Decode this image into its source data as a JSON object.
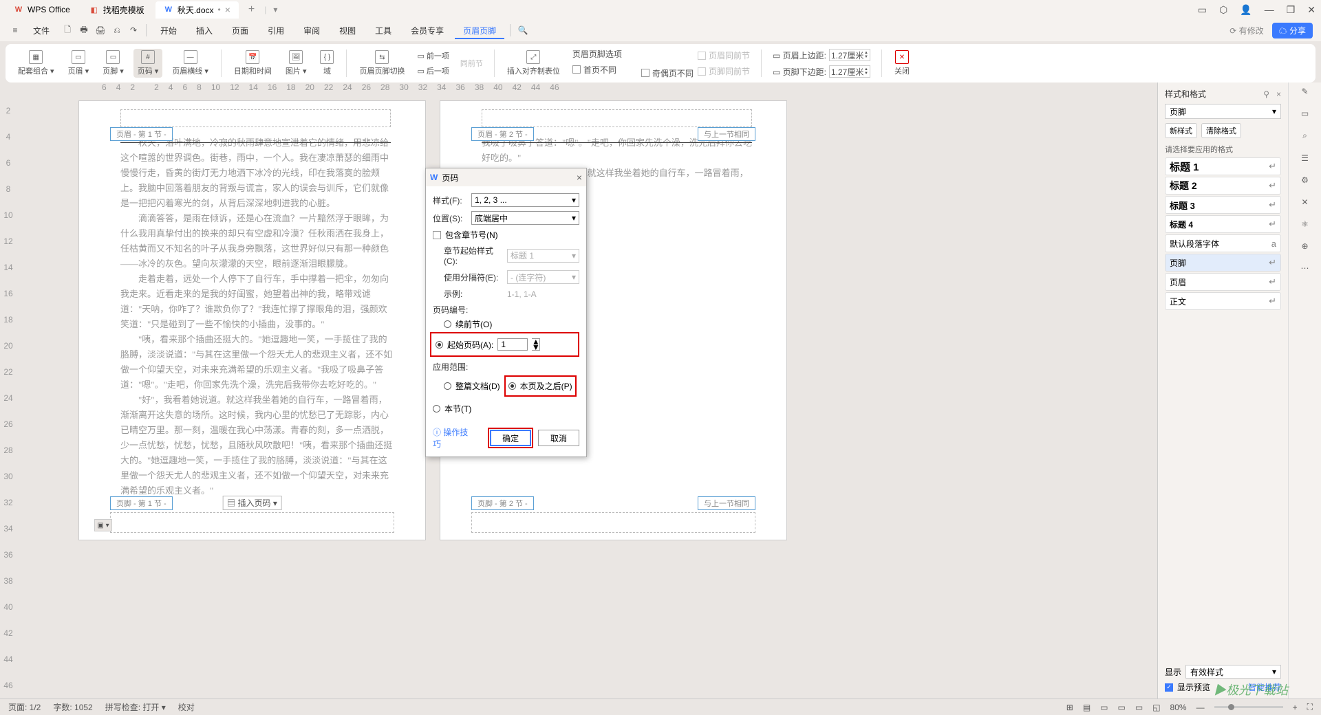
{
  "titlebar": {
    "app": "WPS Office",
    "tabs": [
      {
        "icon": "◧",
        "color": "#d94b3a",
        "label": "找稻壳模板"
      },
      {
        "icon": "W",
        "color": "#3a7afe",
        "label": "秋天.docx",
        "active": true,
        "dirty": "•"
      }
    ],
    "add": "+",
    "win": [
      "▭",
      "⬡",
      "👤",
      "—",
      "❐",
      "✕"
    ]
  },
  "menubar": {
    "left": [
      "≡",
      "文件",
      "🗋",
      "🖶",
      "🖨",
      "⎌",
      "↷"
    ],
    "tabs": [
      "开始",
      "插入",
      "页面",
      "引用",
      "审阅",
      "视图",
      "工具",
      "会员专享",
      "页眉页脚"
    ],
    "active": "页眉页脚",
    "search": "🔍",
    "changes": "⟳ 有修改",
    "share": "☁ 分享"
  },
  "ribbon": {
    "g1": [
      {
        "i": "▦",
        "l": "配套组合 ▾"
      },
      {
        "i": "▭",
        "l": "页眉 ▾"
      },
      {
        "i": "▭",
        "l": "页脚 ▾"
      },
      {
        "i": "#",
        "l": "页码 ▾"
      },
      {
        "i": "—",
        "l": "页眉横线 ▾"
      }
    ],
    "g2": [
      {
        "i": "📅",
        "l": "日期和时间"
      },
      {
        "i": "🖼",
        "l": "图片 ▾"
      },
      {
        "i": "{ }",
        "l": "域"
      }
    ],
    "g3": [
      {
        "i": "⇆",
        "l": "页眉页脚切换"
      }
    ],
    "g3b": [
      {
        "l": "▭ 前一项"
      },
      {
        "l": "▭ 后一项"
      },
      {
        "l": "同前节",
        "dis": true
      }
    ],
    "g4": [
      {
        "i": "⤢",
        "l": "插入对齐制表位"
      }
    ],
    "g4b": [
      {
        "l": "页眉页脚选项"
      },
      {
        "c": true,
        "l": "首页不同"
      },
      {
        "c": true,
        "l": "奇偶页不同"
      }
    ],
    "g4c": [
      {
        "c": true,
        "l": "页眉同前节",
        "dis": true
      },
      {
        "c": true,
        "l": "页脚同前节",
        "dis": true
      }
    ],
    "g5": [
      {
        "l": "▭ 页眉上边距:",
        "v": "1.27厘米"
      },
      {
        "l": "▭ 页脚下边距:",
        "v": "1.27厘米"
      }
    ],
    "g6": [
      {
        "i": "✕",
        "l": "关闭"
      }
    ]
  },
  "ruler": {
    "h": [
      "6",
      "4",
      "2",
      "",
      "2",
      "4",
      "6",
      "8",
      "10",
      "12",
      "14",
      "16",
      "18",
      "20",
      "22",
      "24",
      "26",
      "28",
      "30",
      "32",
      "34",
      "36",
      "38",
      "40",
      "42",
      "44",
      "46"
    ],
    "v": [
      "",
      "2",
      "4",
      "6",
      "8",
      "10",
      "12",
      "14",
      "16",
      "18",
      "20",
      "22",
      "24",
      "26",
      "28",
      "30",
      "32",
      "34",
      "36",
      "38",
      "40",
      "42",
      "44",
      "46"
    ]
  },
  "page1": {
    "hdr": "页眉 - 第 1 节 -",
    "ftr": "页脚 - 第 1 节 -",
    "ins": "▤ 插入页码 ▾",
    "text": "　　秋天，落叶满地，冷寂的秋雨肆意地宣泄着它的情绪，用悲凉给这个喧嚣的世界调色。街巷，雨中，一个人。我在凄凉萧瑟的细雨中慢慢行走，昏黄的街灯无力地洒下冰冷的光线，印在我落寞的脸颊上。我脑中回落着朋友的背叛与谎言，家人的误会与训斥，它们就像是一把把闪着寒光的剑，从背后深深地刺进我的心脏。\n　　滴滴答答，是雨在倾诉，还是心在流血？一片黯然浮于眼眸，为什么我用真挚付出的换来的却只有空虚和冷漠？任秋雨洒在我身上，任枯黄而又不知名的叶子从我身旁飘落，这世界好似只有那一种颜色——冰冷的灰色。望向灰濛濛的天空，眼前逐渐泪眼朦胧。\n　　走着走着，远处一个人停下了自行车，手中撑着一把伞，勿匆向我走来。近看走来的是我的好闺蜜，她望着出神的我，略带戏谑道：\"天呐，你咋了？谁欺负你了？\"我连忙撑了撑眼角的泪，强颜欢笑道：\"只是碰到了一些不愉快的小插曲，没事的。\"\n　　\"咦，看来那个插曲还挺大的。\"她逗趣地一笑，一手揽住了我的胳膊，淡淡说道：\"与其在这里做一个怨天尤人的悲观主义者，还不如做一个仰望天空，对未来充满希望的乐观主义者。\"我吸了吸鼻子答道：\"嗯\"。\"走吧，你回家先洗个澡，洗完后我带你去吃好吃的。\"\n　　\"好\"，我看着她说道。就这样我坐着她的自行车，一路冒着雨，渐渐离开这失意的场所。这时候，我内心里的忧愁已了无踪影，内心已晴空万里。那一刻，温暖在我心中荡漾。青春的刻，多一点洒脱，少一点忧愁，忧愁，忧愁，且随秋风吹散吧！\"咦，看来那个插曲还挺大的。\"她逗趣地一笑，一手揽住了我的胳膊，淡淡说道：\"与其在这里做一个怨天尤人的悲观主义者，还不如做一个仰望天空，对未来充满希望的乐观主义者。\""
  },
  "page2": {
    "hdr": "页眉 - 第 2 节 -",
    "hnext": "与上一节相同",
    "ftr": "页脚 - 第 2 节 -",
    "fnext": "与上一节相同",
    "text": "我吸了吸鼻子答道：\"嗯\"。\"走吧，你回家先洗个澡，洗完后拜你去吃好吃的。\"\n　　\"好\"，我看着她说道。就这样我坐着她的自行车，一路冒着雨，渐"
  },
  "dialog": {
    "title": "页码",
    "style_lbl": "样式(F):",
    "style_val": "1, 2, 3 ...",
    "pos_lbl": "位置(S):",
    "pos_val": "底端居中",
    "include_chap": "包含章节号(N)",
    "chap_style_lbl": "章节起始样式(C):",
    "chap_style_val": "标题 1",
    "sep_lbl": "使用分隔符(E):",
    "sep_val": "-  (连字符)",
    "example_lbl": "示例:",
    "example_val": "1-1, 1-A",
    "numbering": "页码编号:",
    "continue": "续前节(O)",
    "startat": "起始页码(A):",
    "startval": "1",
    "range": "应用范围:",
    "range_all": "整篇文档(D)",
    "range_from": "本页及之后(P)",
    "range_sec": "本节(T)",
    "tips": "ⓘ 操作技巧",
    "ok": "确定",
    "cancel": "取消"
  },
  "sidepanel": {
    "title": "样式和格式",
    "current": "页脚",
    "btns": [
      "新样式",
      "清除格式"
    ],
    "prompt": "请选择要应用的格式",
    "styles": [
      {
        "n": "标题 1",
        "bold": true,
        "size": "15px"
      },
      {
        "n": "标题 2",
        "bold": true,
        "size": "14px"
      },
      {
        "n": "标题 3",
        "bold": true,
        "size": "13px"
      },
      {
        "n": "标题 4",
        "bold": true,
        "size": "12px"
      },
      {
        "n": "默认段落字体",
        "a": "a"
      },
      {
        "n": "页脚",
        "sel": true
      },
      {
        "n": "页眉"
      },
      {
        "n": "正文"
      }
    ],
    "display_lbl": "显示",
    "display_val": "有效样式",
    "preview": "显示预览",
    "smart": "智能推荐"
  },
  "righticons": [
    "✎",
    "▭",
    "⌕",
    "☰",
    "⚙",
    "✕",
    "⚛",
    "⊕",
    "⋯"
  ],
  "statusbar": {
    "page": "页面: 1/2",
    "words": "字数: 1052",
    "spell": "拼写检查: 打开 ▾",
    "proof": "校对",
    "right": [
      "⊞",
      "▤",
      "▭",
      "▭",
      "▭",
      "◱",
      "80%",
      "—",
      "",
      "+",
      "⛶"
    ]
  },
  "watermark": "▶极光下载站"
}
